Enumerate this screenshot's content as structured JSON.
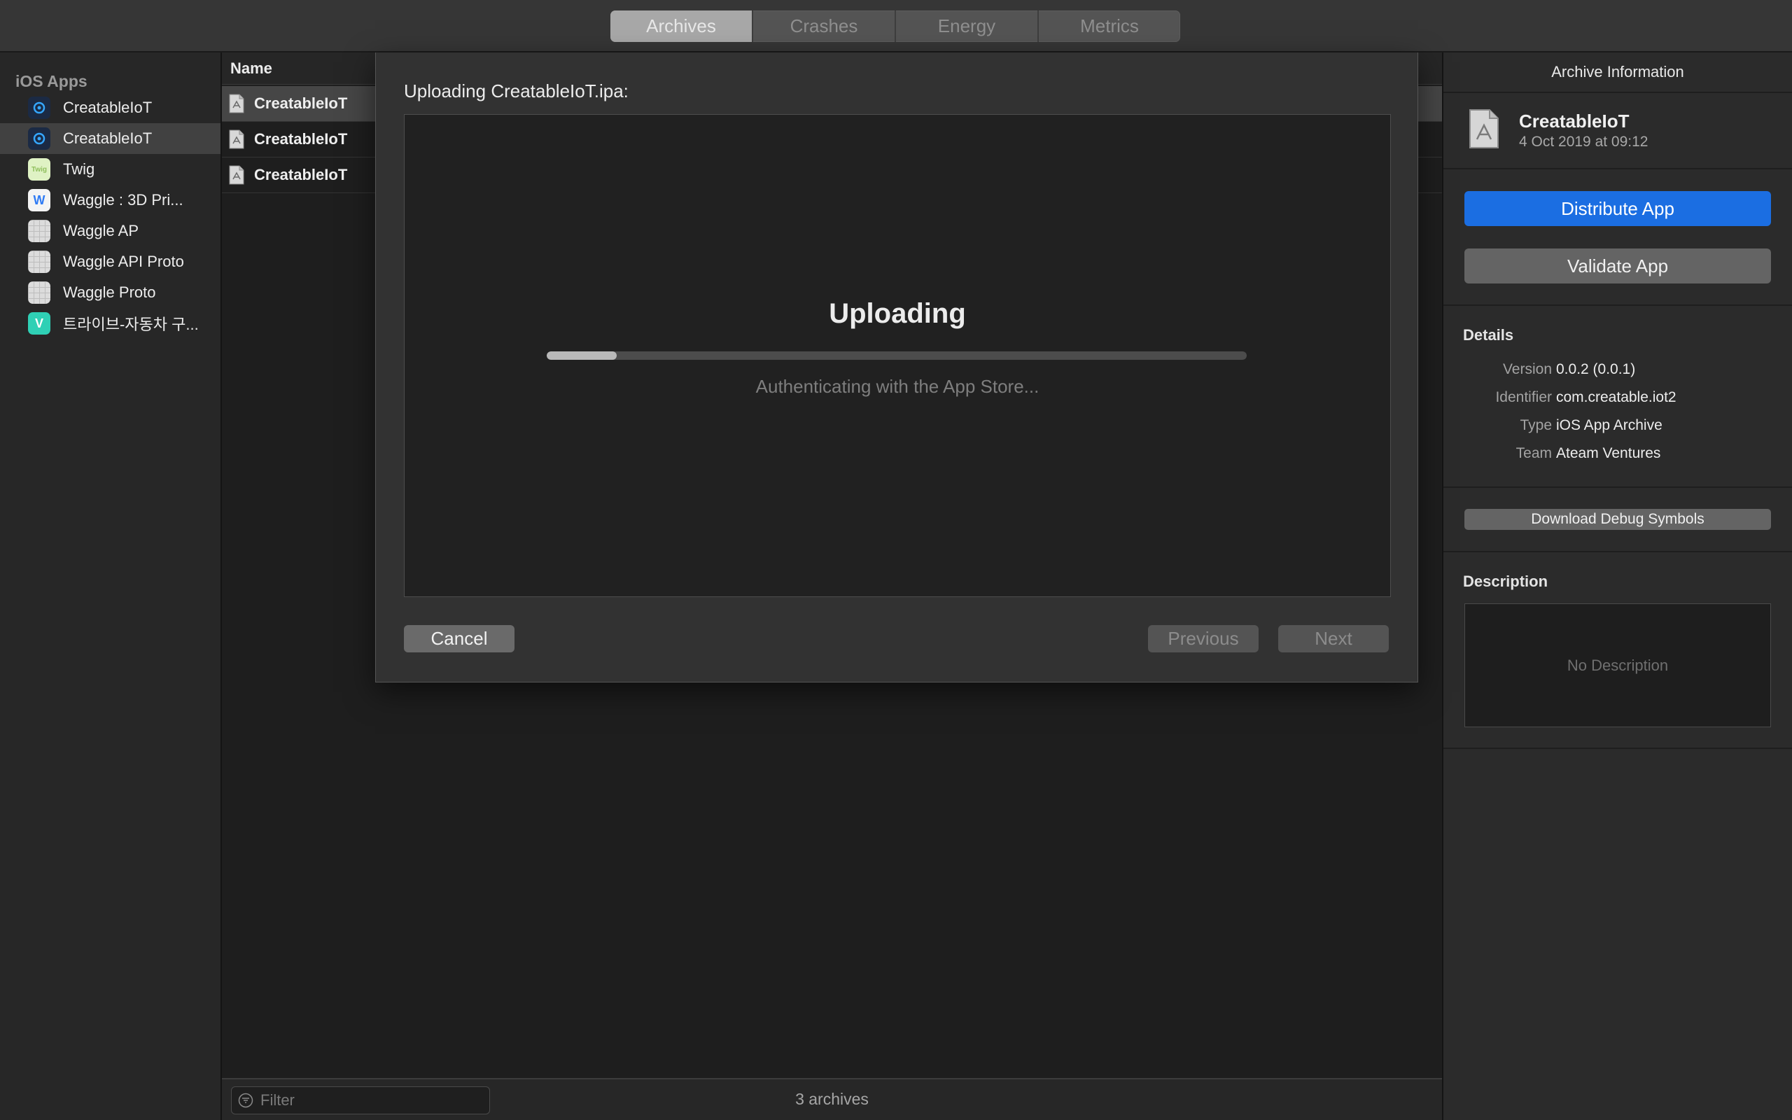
{
  "toolbar": {
    "tabs": [
      {
        "label": "Archives",
        "active": true
      },
      {
        "label": "Crashes",
        "active": false
      },
      {
        "label": "Energy",
        "active": false
      },
      {
        "label": "Metrics",
        "active": false
      }
    ]
  },
  "sidebar": {
    "header": "iOS Apps",
    "items": [
      {
        "label": "CreatableIoT",
        "icon": "creatable-app-icon",
        "selected": false
      },
      {
        "label": "CreatableIoT",
        "icon": "creatable-app-icon",
        "selected": true
      },
      {
        "label": "Twig",
        "icon": "twig-app-icon",
        "icon_text": "Twig",
        "selected": false
      },
      {
        "label": "Waggle : 3D Pri...",
        "icon": "waggle-3d-app-icon",
        "icon_text": "W",
        "selected": false
      },
      {
        "label": "Waggle AP",
        "icon": "placeholder-app-icon",
        "selected": false
      },
      {
        "label": "Waggle API Proto",
        "icon": "placeholder-app-icon",
        "selected": false
      },
      {
        "label": "Waggle Proto",
        "icon": "placeholder-app-icon",
        "selected": false
      },
      {
        "label": "트라이브-자동차 구...",
        "icon": "tribe-app-icon",
        "icon_text": "V",
        "selected": false
      }
    ]
  },
  "archive_list": {
    "column_name": "Name",
    "rows": [
      {
        "name": "CreatableIoT",
        "selected": true
      },
      {
        "name": "CreatableIoT",
        "selected": false
      },
      {
        "name": "CreatableIoT",
        "selected": false
      }
    ],
    "filter_placeholder": "Filter",
    "count_text": "3 archives"
  },
  "inspector": {
    "title": "Archive Information",
    "archive_name": "CreatableIoT",
    "archive_date": "4 Oct 2019 at 09:12",
    "distribute_label": "Distribute App",
    "validate_label": "Validate App",
    "details_title": "Details",
    "details": {
      "version_key": "Version",
      "version": "0.0.2 (0.0.1)",
      "identifier_key": "Identifier",
      "identifier": "com.creatable.iot2",
      "type_key": "Type",
      "type": "iOS App Archive",
      "team_key": "Team",
      "team": "Ateam Ventures"
    },
    "debug_symbols_label": "Download Debug Symbols",
    "description_title": "Description",
    "description": "No Description"
  },
  "modal": {
    "title": "Uploading CreatableIoT.ipa:",
    "heading": "Uploading",
    "progress": 0.1,
    "status": "Authenticating with the App Store...",
    "cancel_label": "Cancel",
    "previous_label": "Previous",
    "next_label": "Next"
  },
  "colors": {
    "accent": "#1b6ee2",
    "window_bg": "#1e1e1e",
    "sidebar_bg": "#272727",
    "modal_bg": "#323232"
  }
}
